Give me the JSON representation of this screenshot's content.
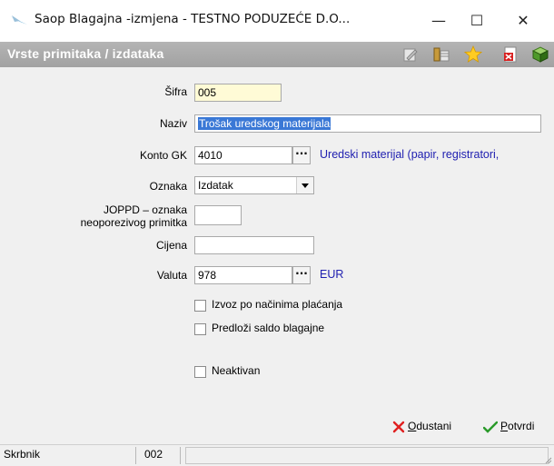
{
  "window": {
    "title": "Saop Blagajna -izmjena  - TESTNO PODUZEĆE D.O...",
    "minimize": "—",
    "maximize": "☐",
    "close": "✕"
  },
  "header": {
    "title": "Vrste primitaka / izdataka",
    "toolbar_icons": [
      "edit-icon",
      "columns-icon",
      "star-icon",
      "delete-icon",
      "export-icon"
    ]
  },
  "form": {
    "sifra": {
      "label": "Šifra",
      "value": "005"
    },
    "naziv": {
      "label": "Naziv",
      "value": "Trošak uredskog materijala"
    },
    "konto": {
      "label": "Konto GK",
      "value": "4010",
      "browse": "···",
      "description": "Uredski materijal (papir, registratori,"
    },
    "oznaka": {
      "label": "Oznaka",
      "value": "Izdatak"
    },
    "joppd": {
      "label_line1": "JOPPD – oznaka",
      "label_line2": "neoporezivog primitka",
      "value": ""
    },
    "cijena": {
      "label": "Cijena",
      "value": ""
    },
    "valuta": {
      "label": "Valuta",
      "value": "978",
      "browse": "···",
      "description": "EUR"
    },
    "checkboxes": {
      "izvoz": {
        "label": "Izvoz po načinima plaćanja",
        "checked": false
      },
      "predlozi": {
        "label": "Predloži saldo blagajne",
        "checked": false
      },
      "neaktivan": {
        "label": "Neaktivan",
        "checked": false
      }
    }
  },
  "buttons": {
    "cancel": {
      "accel": "O",
      "rest": "dustani"
    },
    "confirm": {
      "accel": "P",
      "rest": "otvrdi"
    }
  },
  "status": {
    "user": "Skrbnik",
    "code": "002",
    "message": ""
  },
  "colors": {
    "header_bg": "#a8a8a8",
    "link": "#2020b0",
    "selection": "#3a78d6",
    "required_field": "#fffbd6"
  }
}
